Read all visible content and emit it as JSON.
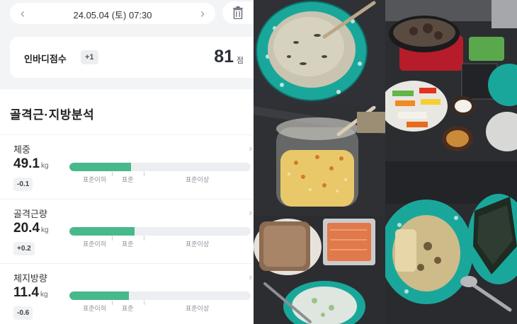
{
  "header": {
    "prev_icon": "chevron-left-icon",
    "date": "24.05.04 (토) 07:30",
    "next_icon": "chevron-right-icon",
    "delete_icon": "trash-icon"
  },
  "score_card": {
    "label": "인바디점수",
    "delta": "+1",
    "score": "81",
    "unit": "점"
  },
  "analysis": {
    "title": "골격근·지방분석",
    "scale_labels": [
      "표준이하",
      "표준",
      "표준이상"
    ],
    "metrics": [
      {
        "label": "체중",
        "value": "49.1",
        "unit": "kg",
        "delta": "-0.1",
        "level": 0.34
      },
      {
        "label": "골격근량",
        "value": "20.4",
        "unit": "kg",
        "delta": "+0.2",
        "level": 0.36
      },
      {
        "label": "체지방량",
        "value": "11.4",
        "unit": "kg",
        "delta": "-0.6",
        "level": 0.33
      }
    ]
  },
  "colors": {
    "accent_green": "#47b98a",
    "bowl_teal": "#1aa79b"
  }
}
